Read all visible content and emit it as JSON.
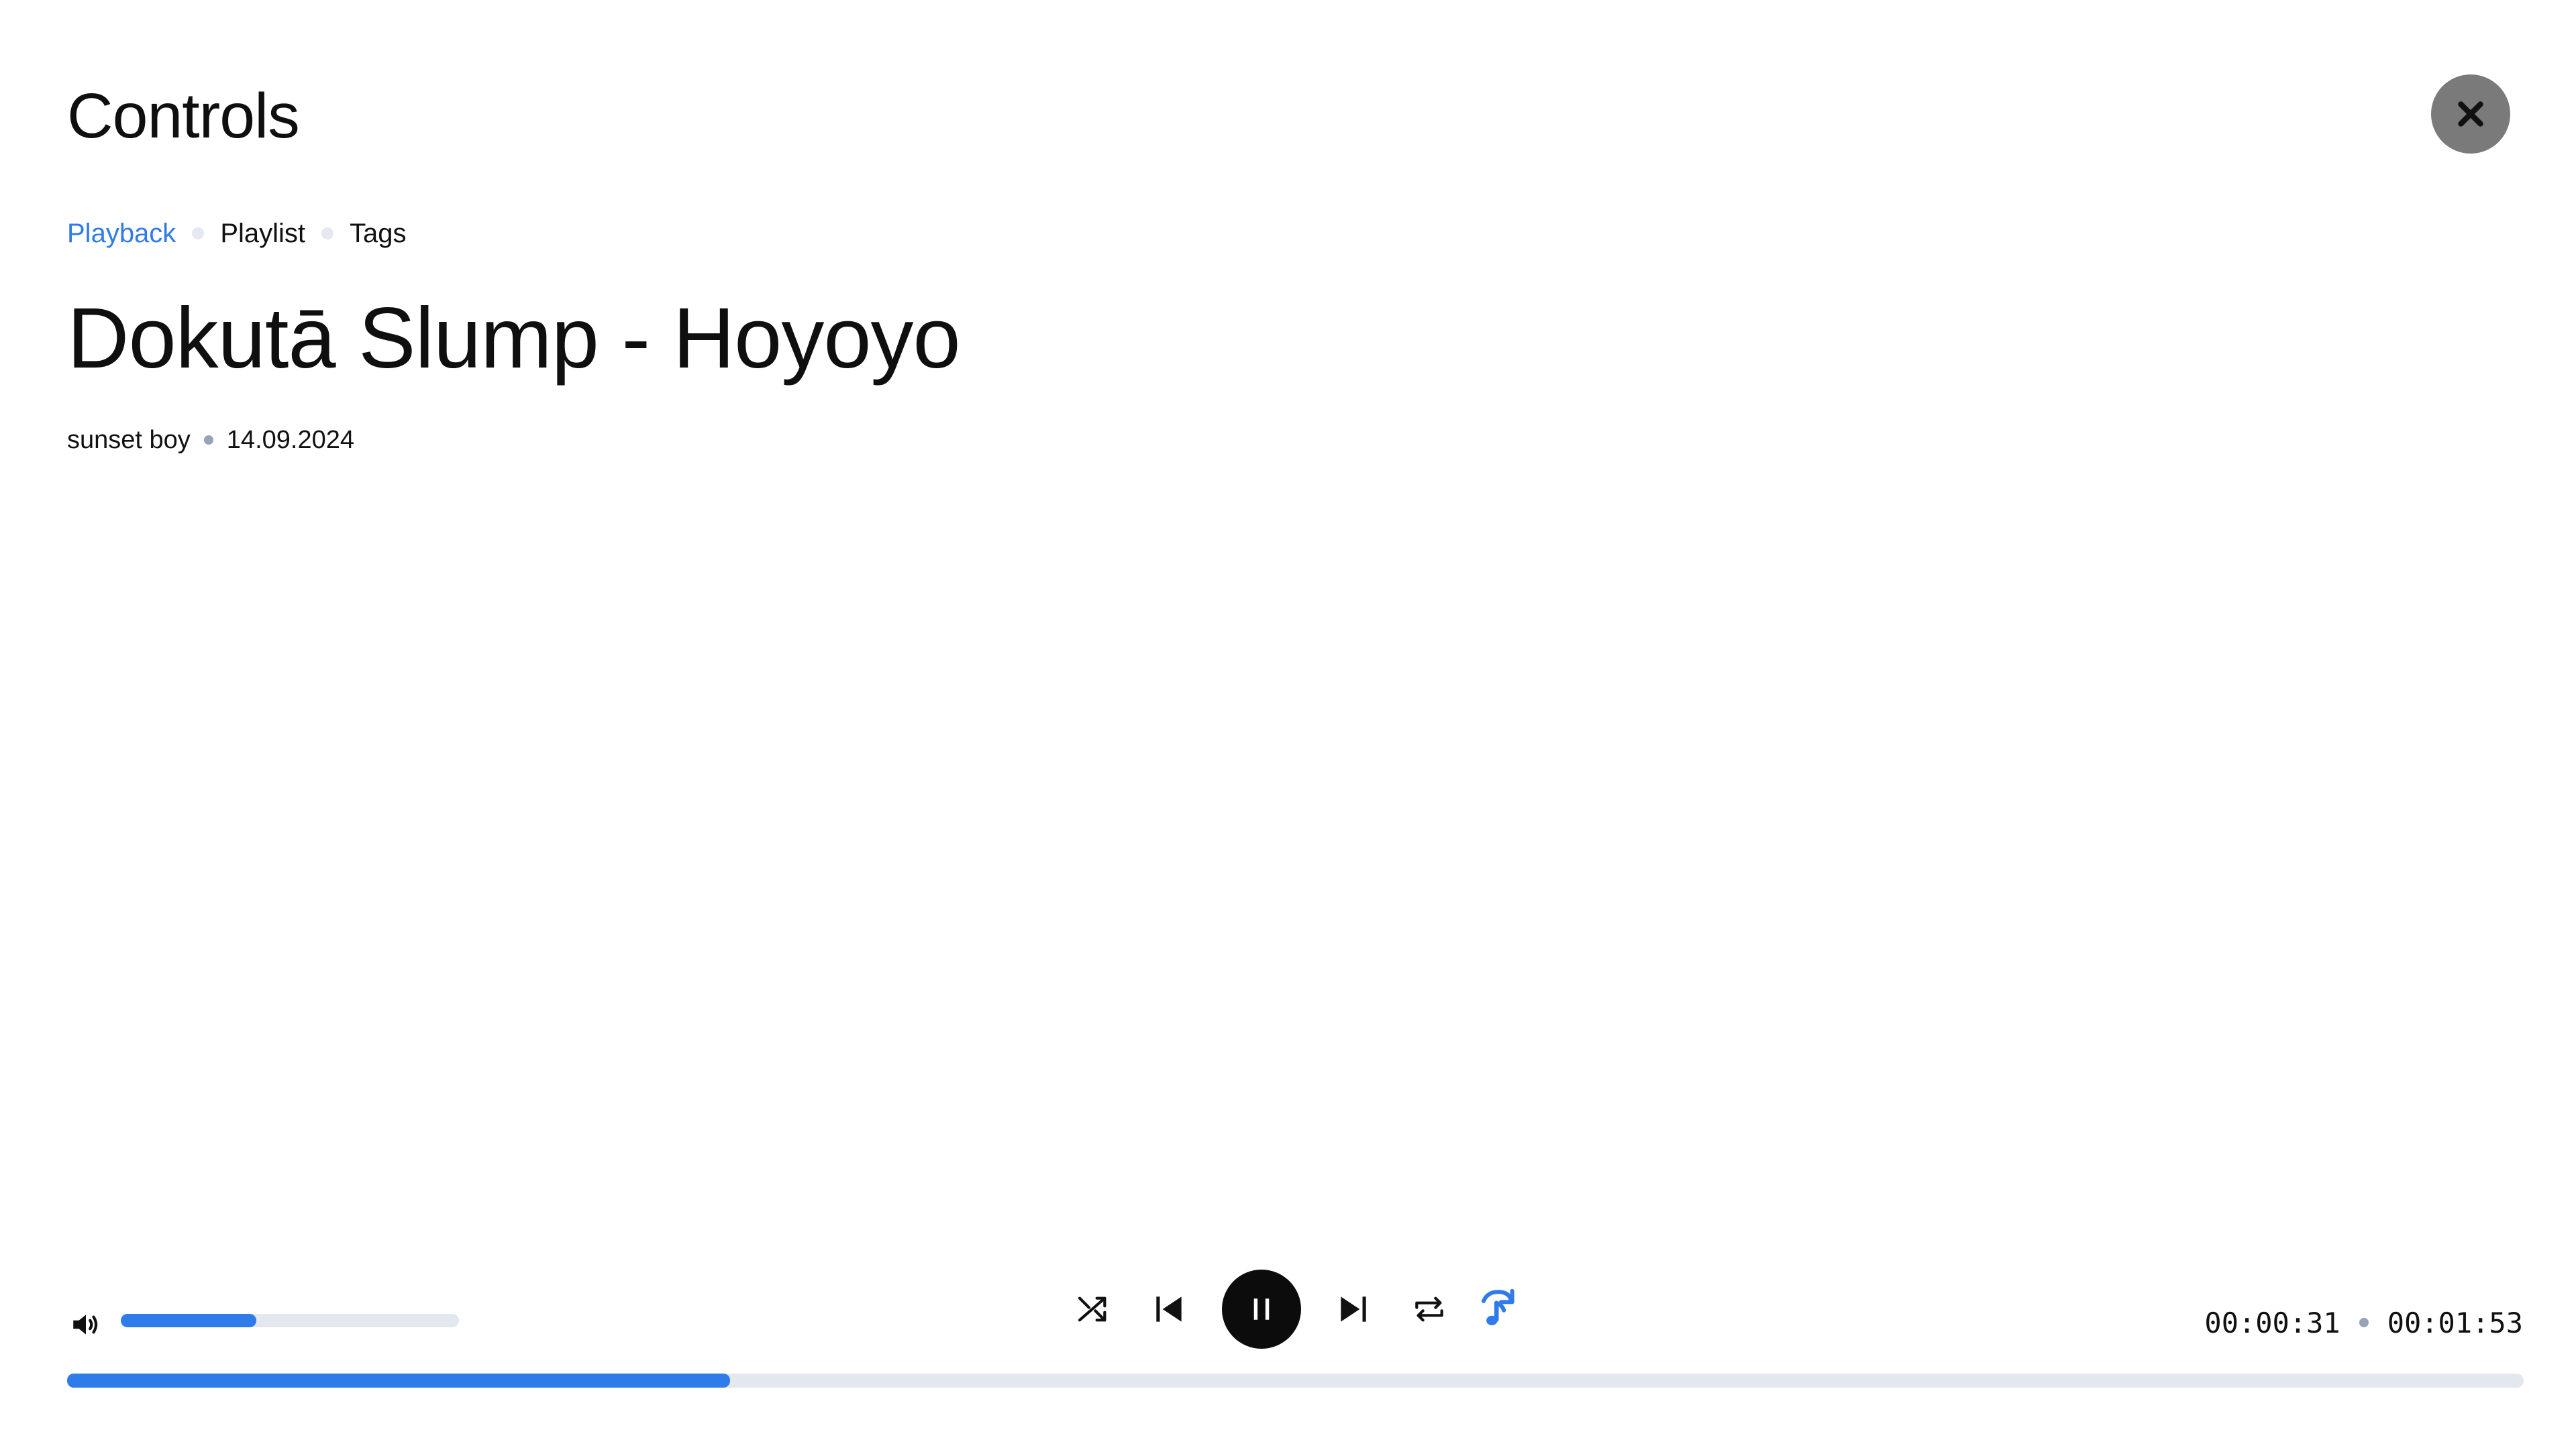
{
  "header": {
    "title": "Controls",
    "close_icon": "close-icon"
  },
  "tabs": [
    {
      "label": "Playback",
      "active": true
    },
    {
      "label": "Playlist",
      "active": false
    },
    {
      "label": "Tags",
      "active": false
    }
  ],
  "track": {
    "title": "Dokutā Slump - Hoyoyo",
    "artist": "sunset boy",
    "date": "14.09.2024"
  },
  "player": {
    "volume_icon": "volume-icon",
    "volume_level": 0.4,
    "controls": {
      "shuffle_icon": "shuffle-icon",
      "previous_icon": "skip-previous-icon",
      "play_pause_icon": "pause-icon",
      "next_icon": "skip-next-icon",
      "repeat_icon": "repeat-icon",
      "autoplay_icon": "music-note-autoplay-icon"
    },
    "time_current": "00:00:31",
    "time_total": "00:01:53",
    "progress": 0.27
  },
  "colors": {
    "accent": "#2f7bea",
    "track": "#e3e7ee",
    "close_bg": "#7a7a7a",
    "play_bg": "#0c0c0c",
    "separator": "#98a3b8"
  }
}
